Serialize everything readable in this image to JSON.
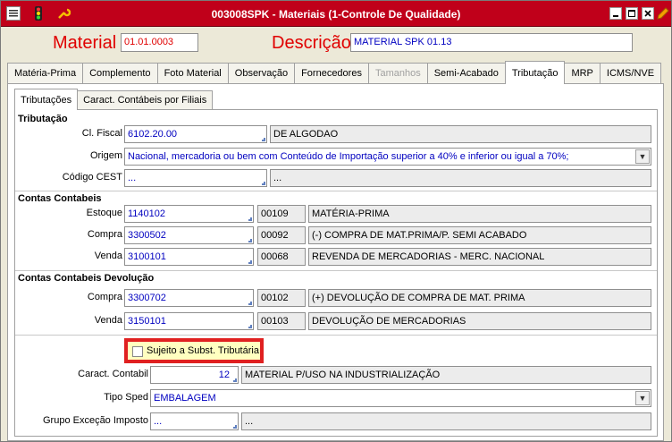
{
  "window": {
    "title": "003008SPK - Materiais (1-Controle De Qualidade)"
  },
  "colors": {
    "titlebar": "#c0001a",
    "label_red": "#e00000",
    "value_blue": "#0000c0",
    "highlight": "#e02020"
  },
  "header": {
    "material_label": "Material",
    "material_value": "01.01.0003",
    "descricao_label": "Descrição",
    "descricao_value": "MATERIAL SPK 01.13"
  },
  "tabs": [
    {
      "label": "Matéria-Prima"
    },
    {
      "label": "Complemento"
    },
    {
      "label": "Foto Material"
    },
    {
      "label": "Observação"
    },
    {
      "label": "Fornecedores"
    },
    {
      "label": "Tamanhos"
    },
    {
      "label": "Semi-Acabado"
    },
    {
      "label": "Tributação"
    },
    {
      "label": "MRP"
    },
    {
      "label": "ICMS/NVE"
    }
  ],
  "subtabs": [
    {
      "label": "Tributações"
    },
    {
      "label": "Caract. Contábeis por Filiais"
    }
  ],
  "tributacao": {
    "title": "Tributação",
    "cl_fiscal_label": "Cl. Fiscal",
    "cl_fiscal_code": "6102.20.00",
    "cl_fiscal_desc": "DE ALGODAO",
    "origem_label": "Origem",
    "origem_value": "Nacional, mercadoria ou bem com Conteúdo de Importação superior a 40% e inferior ou igual a 70%;",
    "cest_label": "Código CEST",
    "cest_code": "...",
    "cest_desc": "..."
  },
  "contas": {
    "title": "Contas Contabeis",
    "rows": [
      {
        "label": "Estoque",
        "code": "1140102",
        "num": "00109",
        "desc": "MATÉRIA-PRIMA"
      },
      {
        "label": "Compra",
        "code": "3300502",
        "num": "00092",
        "desc": "(-) COMPRA DE MAT.PRIMA/P. SEMI ACABADO"
      },
      {
        "label": "Venda",
        "code": "3100101",
        "num": "00068",
        "desc": "REVENDA DE MERCADORIAS - MERC. NACIONAL"
      }
    ]
  },
  "devolucao": {
    "title": "Contas Contabeis Devolução",
    "rows": [
      {
        "label": "Compra",
        "code": "3300702",
        "num": "00102",
        "desc": "(+) DEVOLUÇÃO DE COMPRA DE MAT. PRIMA"
      },
      {
        "label": "Venda",
        "code": "3150101",
        "num": "00103",
        "desc": "DEVOLUÇÃO DE MERCADORIAS"
      }
    ]
  },
  "extra": {
    "subst_label": "Sujeito a Subst. Tributária",
    "caract_label": "Caract. Contabil",
    "caract_code": "12",
    "caract_desc": "MATERIAL P/USO NA INDUSTRIALIZAÇÃO",
    "tipo_sped_label": "Tipo Sped",
    "tipo_sped_value": "EMBALAGEM",
    "grupo_label": "Grupo Exceção Imposto",
    "grupo_code": "...",
    "grupo_desc": "..."
  }
}
